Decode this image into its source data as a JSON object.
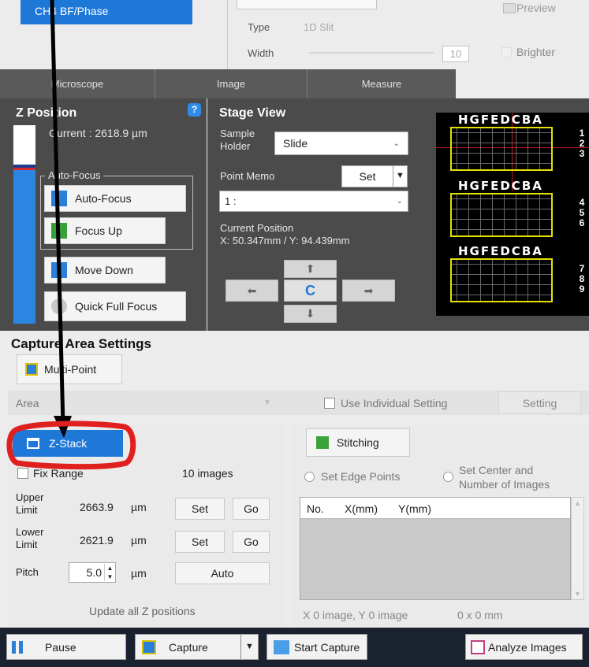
{
  "top": {
    "channel_label": "CH4 BF/Phase",
    "type_label": "Type",
    "type_value": "1D Slit",
    "width_label": "Width",
    "width_value": "10",
    "preview_label": "Preview",
    "brighter_label": "Brighter"
  },
  "tabs": [
    {
      "label": "Microscope"
    },
    {
      "label": "Image"
    },
    {
      "label": "Measure"
    }
  ],
  "z_position": {
    "title": "Z Position",
    "help": "?",
    "current": "Current : 2618.9 µm",
    "autofocus_group": "Auto-Focus",
    "autofocus_btn": "Auto-Focus",
    "focus_up_btn": "Focus Up",
    "move_down_btn": "Move Down",
    "quick_full_focus_btn": "Quick Full Focus"
  },
  "stage_view": {
    "title": "Stage View",
    "sample_holder_label": "Sample Holder",
    "sample_holder_value": "Slide",
    "point_memo_label": "Point Memo",
    "set_btn": "Set",
    "point_memo_value": "1 :",
    "current_position_label": "Current Position",
    "current_position_value": "X: 50.347mm / Y: 94.439mm",
    "center_btn": "C",
    "plate_letters": "HGFEDCBA",
    "plate_rows": [
      [
        "1",
        "2",
        "3"
      ],
      [
        "4",
        "5",
        "6"
      ],
      [
        "7",
        "8",
        "9"
      ]
    ]
  },
  "capture_area": {
    "title": "Capture Area Settings",
    "multipoint_btn": "Multi-Point",
    "area_label": "Area",
    "use_individual_label": "Use Individual Setting",
    "setting_btn": "Setting"
  },
  "zstack": {
    "btn": "Z-Stack",
    "fix_range_label": "Fix Range",
    "images_count": "10 images",
    "upper_label": "Upper Limit",
    "upper_value": "2663.9",
    "lower_label": "Lower Limit",
    "lower_value": "2621.9",
    "pitch_label": "Pitch",
    "pitch_value": "5.0",
    "unit": "µm",
    "set_btn": "Set",
    "go_btn": "Go",
    "auto_btn": "Auto",
    "update_all": "Update all Z positions"
  },
  "stitching": {
    "btn": "Stitching",
    "edge_points_label": "Set Edge Points",
    "center_label": "Set Center and Number of Images",
    "table_headers": [
      "No.",
      "X(mm)",
      "Y(mm)"
    ],
    "summary": "X 0 image, Y 0 image",
    "size": "0 x 0 mm"
  },
  "bottom_bar": {
    "pause": "Pause",
    "capture": "Capture",
    "start_capture": "Start Capture",
    "analyze_images": "Analyze Images"
  },
  "colors": {
    "accent_blue": "#1e78d8",
    "dark_panel": "#4b4b4b",
    "annotation_red": "#e0201e",
    "plate_yellow": "#e4e000"
  }
}
